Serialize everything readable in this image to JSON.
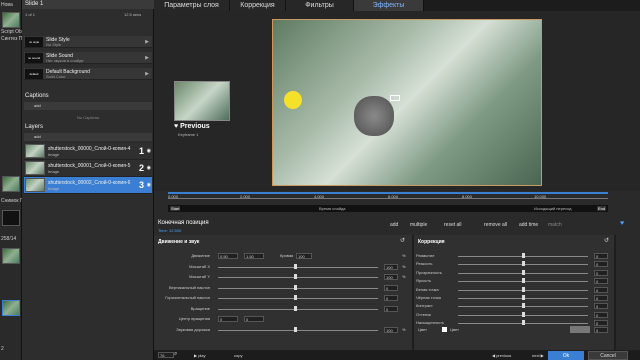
{
  "strip": {
    "new": "Нова",
    "items": [
      "Script Obje",
      "Синтез П",
      "Снимок П"
    ],
    "num": "258/14",
    "pg": "2"
  },
  "slide": {
    "title": "Slide 1",
    "count": "1 of 1",
    "duration": "12.5 secs",
    "rows": [
      {
        "thumb": "no style",
        "t1": "Slide Style",
        "t2": "No Style"
      },
      {
        "thumb": "no sound",
        "t1": "Slide Sound",
        "t2": "Нет звуков в слайде"
      },
      {
        "thumb": "default",
        "t1": "Default Background",
        "t2": "Solid Color"
      }
    ]
  },
  "captions": {
    "title": "Captions",
    "add": "add",
    "empty": "No Captions"
  },
  "layers": {
    "title": "Layers",
    "add": "add",
    "items": [
      {
        "name": "shutterstock_00000_Слой-0-копия-4",
        "type": "Image",
        "num": "1",
        "selected": false
      },
      {
        "name": "shutterstock_00001_Слой-0-копия-5",
        "type": "Image",
        "num": "2",
        "selected": false
      },
      {
        "name": "shutterstock_00002_Слой-0-копия-6",
        "type": "Image",
        "num": "3",
        "selected": true
      }
    ]
  },
  "tabs": [
    "Параметры слоя",
    "Коррекция",
    "Фильтры",
    "Эффекты"
  ],
  "previous": {
    "label": "Previous",
    "sub": "Keyframe 1"
  },
  "timeline": {
    "ticks": [
      "0.000",
      "2.000",
      "4.000",
      "6.000",
      "8.000",
      "10.000"
    ],
    "start": "Start",
    "end": "End",
    "mid": "Время слайда",
    "right": "Исходящий переход"
  },
  "kf": {
    "title": "Конечная позиция",
    "time": "Time: 12.500",
    "actions": [
      "add",
      "multiple",
      "reset all",
      "remove all",
      "add time",
      "match"
    ]
  },
  "motion": {
    "title": "Движение и звук",
    "rows": [
      {
        "label": "Движение",
        "v1": "0.50",
        "v2": "1.50",
        "l2": "Кривая",
        "v3": "100",
        "u": "%"
      },
      {
        "label": "Масштаб X",
        "val": "100",
        "u": "%"
      },
      {
        "label": "Масштаб Y",
        "val": "100",
        "u": "%"
      },
      {
        "label": "Вертикальный наклон",
        "val": "0"
      },
      {
        "label": "Горизонтальный наклон",
        "val": "0"
      },
      {
        "label": "Вращение",
        "val": "0"
      },
      {
        "label": "Центр вращения",
        "v1": "0",
        "v2": "0"
      },
      {
        "label": "Звуковая дорожка",
        "val": "100",
        "u": "%"
      }
    ]
  },
  "correction": {
    "title": "Коррекция",
    "rows": [
      {
        "label": "Размытие",
        "val": "0"
      },
      {
        "label": "Резкость",
        "val": "0"
      },
      {
        "label": "Прозрачность",
        "val": "0"
      },
      {
        "label": "Яркость",
        "val": "0"
      },
      {
        "label": "Белая точка",
        "val": "0"
      },
      {
        "label": "Чёрная точка",
        "val": "0"
      },
      {
        "label": "Контраст",
        "val": "0"
      },
      {
        "label": "Оттенок",
        "val": "0"
      },
      {
        "label": "Насыщенность",
        "val": "0"
      }
    ],
    "color_label": "Цвет",
    "color_check": "Цвет",
    "color_val": "0"
  },
  "bottom": {
    "zoom": "76",
    "play": "play",
    "copy": "copy",
    "prev": "previous",
    "next": "next",
    "ok": "Ok",
    "cancel": "Cancel"
  }
}
